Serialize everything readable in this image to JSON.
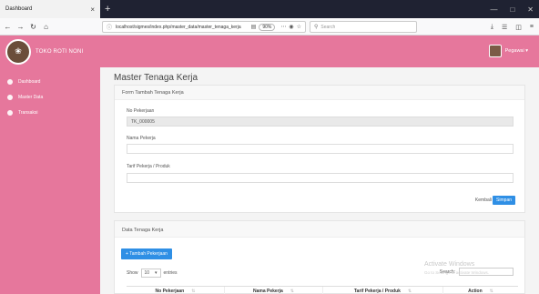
{
  "browser": {
    "tab_title": "Dashboard",
    "tab_close": "×",
    "new_tab": "+",
    "url": "localhost/sigmes/index.php/master_data/master_tenaga_kerja",
    "zoom": "90%",
    "search_placeholder": "Search"
  },
  "header": {
    "brand": "TOKO ROTI NONI",
    "user": "Pegawai ▾"
  },
  "sidebar": {
    "items": [
      {
        "label": "Dashboard"
      },
      {
        "label": "Master Data"
      },
      {
        "label": "Transaksi"
      }
    ]
  },
  "main": {
    "page_title": "Master Tenaga Kerja",
    "form": {
      "title": "Form Tambah Tenaga Kerja",
      "no_label": "No Pekerjaan",
      "no_value": "TK_000005",
      "nama_label": "Nama Pekerja",
      "tarif_label": "Tarif Pekerja / Produk",
      "kembali": "Kembali",
      "simpan": "Simpan"
    },
    "table_card": {
      "title": "Data Tenaga Kerja",
      "add_button": "+ Tambah Pekerjaan",
      "show_label": "Show",
      "show_value": "10",
      "entries_label": "entries",
      "search_label": "Search:",
      "columns": [
        "No Pekerjaan",
        "Nama Pekerja",
        "Tarif Pekerja / Produk",
        "Action"
      ]
    }
  },
  "watermark": {
    "line1": "Activate Windows",
    "line2": "Go to Settings to activate Windows."
  }
}
